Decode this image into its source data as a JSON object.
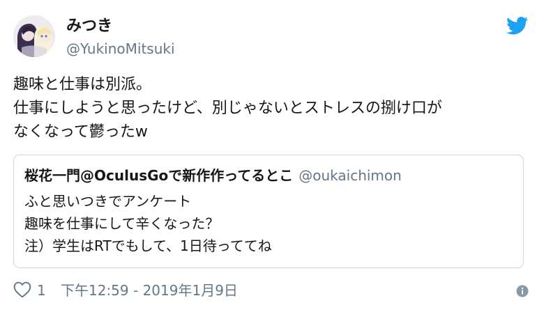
{
  "user": {
    "display_name": "みつき",
    "handle": "@YukinoMitsuki"
  },
  "tweet": {
    "lines": [
      "趣味と仕事は別派。",
      "仕事にしようと思ったけど、別じゃないとストレスの捌け口が",
      "なくなって鬱ったw"
    ]
  },
  "quoted_tweet": {
    "display_name": "桜花一門@OculusGoで新作作ってるとこ",
    "handle": "@oukaichimon",
    "lines": [
      "ふと思いつきでアンケート",
      "趣味を仕事にして辛くなった？",
      "注）学生はRTでもして、1日待っててね"
    ]
  },
  "footer": {
    "like_count": "1",
    "timestamp": "下午12:59 - 2019年1月9日"
  },
  "icons": {
    "brand": "twitter-bird-icon",
    "like": "heart-icon",
    "info": "info-icon"
  },
  "colors": {
    "brand_blue": "#1da1f2",
    "secondary_text": "#657786",
    "border": "#ccd6dd"
  }
}
